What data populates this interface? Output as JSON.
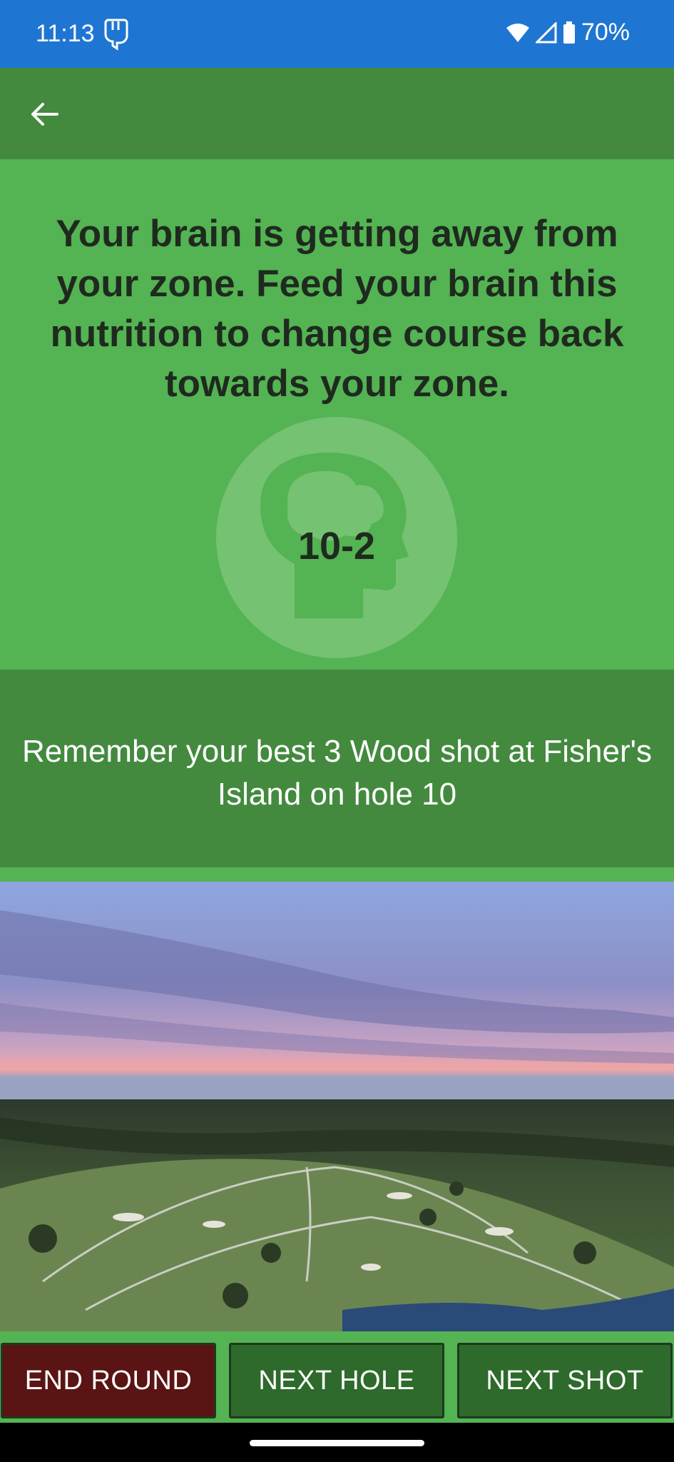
{
  "status_bar": {
    "time": "11:13",
    "battery_percent": "70%",
    "icons": [
      "app-hand-icon",
      "wifi-icon",
      "signal-icon",
      "battery-icon"
    ]
  },
  "app_bar": {
    "back_icon": "arrow-left-icon"
  },
  "header": {
    "message": "Your brain is getting away from your zone. Feed your brain this nutrition to change course back towards your zone.",
    "zone_code": "10-2",
    "info_icon": "info-circle-icon"
  },
  "tip": {
    "text": "Remember your best 3 Wood shot at Fisher's Island on hole 10"
  },
  "photo": {
    "subject": "aerial golf course at dusk"
  },
  "buttons": {
    "end_round": "END ROUND",
    "next_hole": "NEXT HOLE",
    "next_shot": "NEXT SHOT"
  },
  "colors": {
    "status_bar": "#1f76d2",
    "app_bar": "#438a3f",
    "panel_green": "#54b353",
    "end_round": "#5a1414",
    "action_button": "#2e6a2b"
  }
}
